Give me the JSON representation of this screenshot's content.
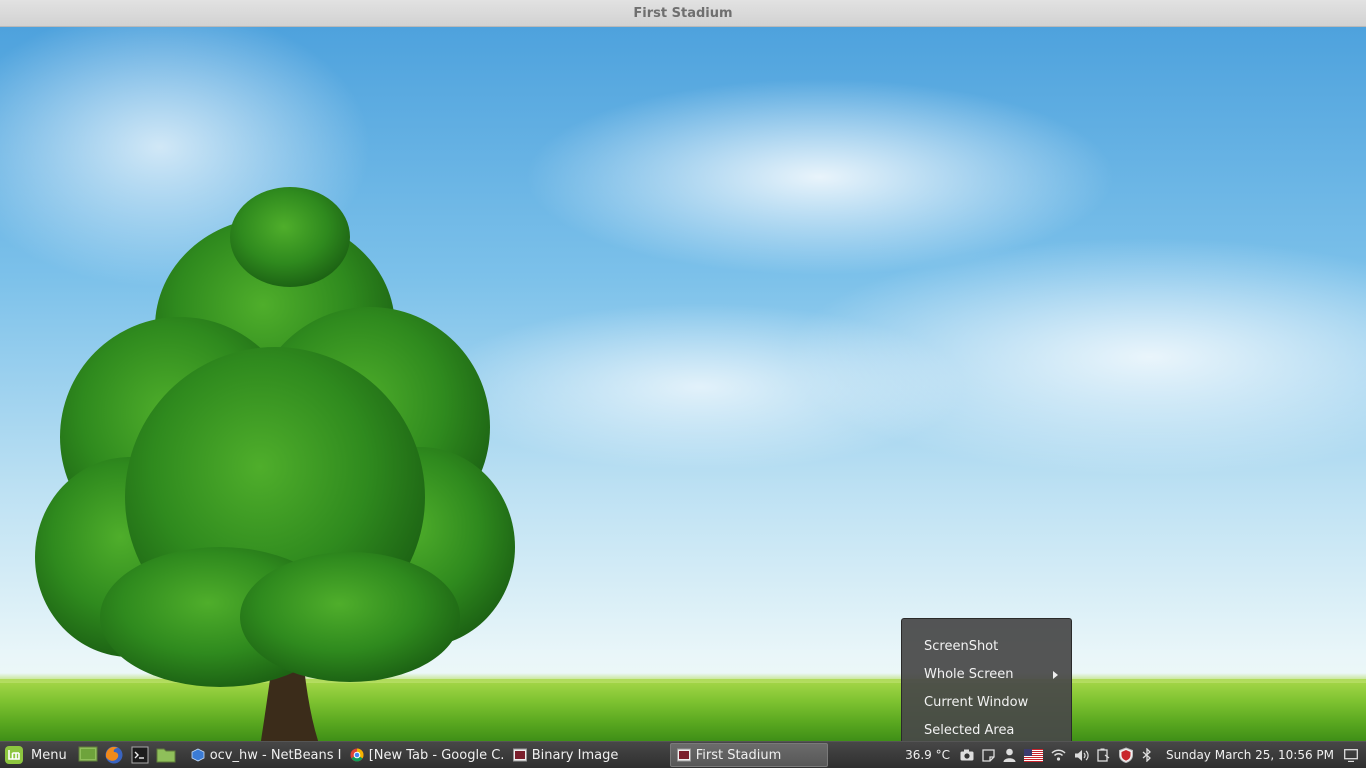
{
  "window": {
    "title": "First Stadium"
  },
  "taskbar": {
    "menu_label": "Menu",
    "launchers": [
      {
        "icon": "show-desktop-icon"
      },
      {
        "icon": "firefox-icon"
      },
      {
        "icon": "terminal-icon"
      },
      {
        "icon": "files-icon"
      }
    ],
    "windows": [
      {
        "label": "ocv_hw - NetBeans I...",
        "icon": "netbeans-icon"
      },
      {
        "label": "[New Tab - Google C...",
        "icon": "chrome-icon"
      },
      {
        "label": "Binary Image",
        "icon": "app-window-icon"
      },
      {
        "label": "First Stadium",
        "icon": "app-window-icon",
        "active": true
      }
    ],
    "tray": {
      "temperature": "36.9 °C",
      "icons": [
        "camera-icon",
        "notes-icon",
        "user-icon",
        "us-flag-icon",
        "wifi-icon",
        "volume-icon",
        "battery-icon",
        "shield-icon",
        "bluetooth-icon"
      ],
      "clock": "Sunday March 25, 10:56 PM",
      "end_icon": "show-desktop-icon"
    }
  },
  "screenshot_menu": {
    "title": "ScreenShot",
    "items": [
      {
        "label": "Whole Screen",
        "has_submenu": true
      },
      {
        "label": "Current Window"
      },
      {
        "label": "Selected Area"
      }
    ]
  },
  "colors": {
    "titlebar": "#d8d8d8",
    "taskbar": "#3a3a3a",
    "menu_bg": "#484848",
    "mint_green": "#8dc63f"
  }
}
